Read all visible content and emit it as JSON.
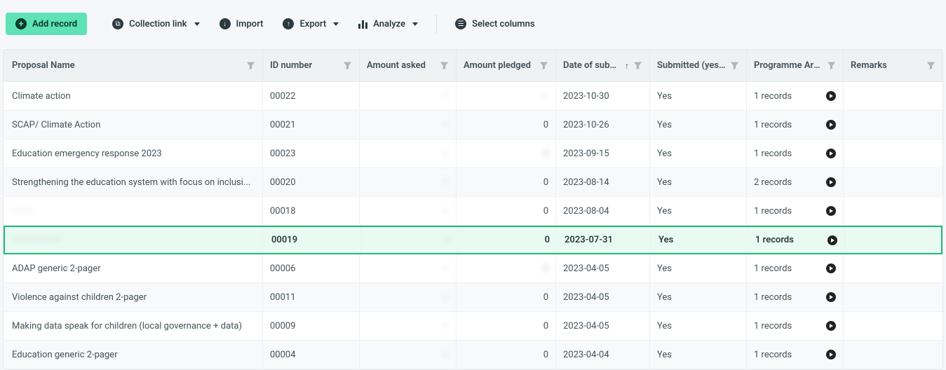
{
  "toolbar": {
    "add_label": "Add record",
    "collection_link_label": "Collection link",
    "import_label": "Import",
    "export_label": "Export",
    "analyze_label": "Analyze",
    "select_columns_label": "Select columns"
  },
  "columns": {
    "name": "Proposal Name",
    "id": "ID number",
    "asked": "Amount asked",
    "pledged": "Amount pledged",
    "date": "Date of submi...",
    "submitted": "Submitted (yes...",
    "programme": "Programme Area",
    "remarks": "Remarks"
  },
  "rows": [
    {
      "name": "Climate action",
      "name_blur": false,
      "id": "00022",
      "asked": "—",
      "pledged": "—",
      "pledged_blur": true,
      "date": "2023-10-30",
      "submitted": "Yes",
      "programme": "1 records",
      "remarks": "",
      "highlight": false
    },
    {
      "name": "SCAP/ Climate Action",
      "name_blur": false,
      "id": "00021",
      "asked": "—",
      "pledged": "0",
      "pledged_blur": false,
      "date": "2023-10-26",
      "submitted": "Yes",
      "programme": "1 records",
      "remarks": "",
      "highlight": false
    },
    {
      "name": "Education emergency response 2023",
      "name_blur": false,
      "id": "00023",
      "asked": "—",
      "pledged": "0",
      "pledged_blur": true,
      "date": "2023-09-15",
      "submitted": "Yes",
      "programme": "1 records",
      "remarks": "",
      "highlight": false
    },
    {
      "name": "Strengthening the education system with focus on inclusi...",
      "name_blur": false,
      "id": "00020",
      "asked": "—",
      "pledged": "0",
      "pledged_blur": false,
      "date": "2023-08-14",
      "submitted": "Yes",
      "programme": "2 records",
      "remarks": "",
      "highlight": false
    },
    {
      "name": "———",
      "name_blur": true,
      "id": "00018",
      "asked": "—",
      "pledged": "0",
      "pledged_blur": false,
      "date": "2023-08-04",
      "submitted": "Yes",
      "programme": "1 records",
      "remarks": "",
      "highlight": false
    },
    {
      "name": "———————",
      "name_blur": true,
      "id": "00019",
      "asked": "—",
      "pledged": "0",
      "pledged_blur": false,
      "date": "2023-07-31",
      "submitted": "Yes",
      "programme": "1 records",
      "remarks": "",
      "highlight": true
    },
    {
      "name": "ADAP generic 2-pager",
      "name_blur": false,
      "id": "00006",
      "asked": "—",
      "pledged": "0",
      "pledged_blur": true,
      "date": "2023-04-05",
      "submitted": "Yes",
      "programme": "1 records",
      "remarks": "",
      "highlight": false
    },
    {
      "name": "Violence against children 2-pager",
      "name_blur": false,
      "id": "00011",
      "asked": "—",
      "pledged": "0",
      "pledged_blur": false,
      "date": "2023-04-05",
      "submitted": "Yes",
      "programme": "1 records",
      "remarks": "",
      "highlight": false
    },
    {
      "name": "Making data speak for children (local governance + data)",
      "name_blur": false,
      "id": "00009",
      "asked": "—",
      "pledged": "0",
      "pledged_blur": false,
      "date": "2023-04-05",
      "submitted": "Yes",
      "programme": "1 records",
      "remarks": "",
      "highlight": false
    },
    {
      "name": "Education generic 2-pager",
      "name_blur": false,
      "id": "00004",
      "asked": "—",
      "pledged": "0",
      "pledged_blur": false,
      "date": "2023-04-04",
      "submitted": "Yes",
      "programme": "1 records",
      "remarks": "",
      "highlight": false
    }
  ]
}
